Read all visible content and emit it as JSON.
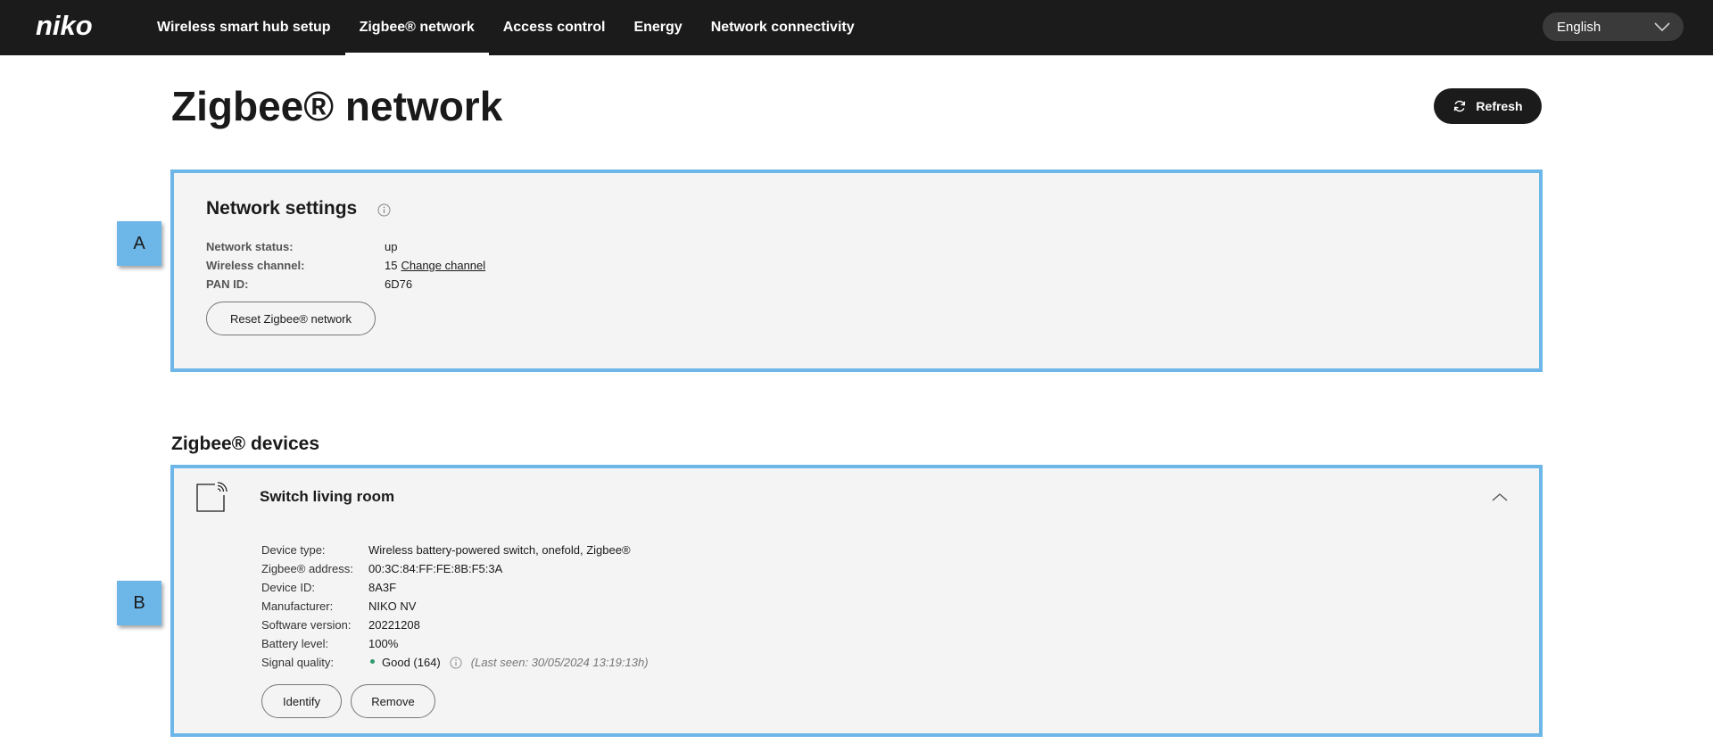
{
  "brand": {
    "logo_text": "niko"
  },
  "nav": {
    "items": [
      {
        "label": "Wireless smart hub setup"
      },
      {
        "label": "Zigbee® network",
        "active": true
      },
      {
        "label": "Access control"
      },
      {
        "label": "Energy"
      },
      {
        "label": "Network connectivity"
      }
    ],
    "language": "English"
  },
  "page": {
    "title": "Zigbee® network",
    "refresh_label": "Refresh"
  },
  "markers": {
    "a": "A",
    "b": "B"
  },
  "network_settings": {
    "title": "Network settings",
    "status_label": "Network status:",
    "status_value": "up",
    "channel_label": "Wireless channel:",
    "channel_value": "15",
    "change_channel_label": "Change channel",
    "pan_label": "PAN ID:",
    "pan_value": "6D76",
    "reset_label": "Reset Zigbee® network"
  },
  "devices": {
    "section_title": "Zigbee® devices",
    "device": {
      "name": "Switch living room",
      "type_label": "Device type:",
      "type_value": "Wireless battery-powered switch, onefold, Zigbee®",
      "address_label": "Zigbee® address:",
      "address_value": "00:3C:84:FF:FE:8B:F5:3A",
      "id_label": "Device ID:",
      "id_value": "8A3F",
      "manufacturer_label": "Manufacturer:",
      "manufacturer_value": "NIKO NV",
      "software_label": "Software version:",
      "software_value": "20221208",
      "battery_label": "Battery level:",
      "battery_value": "100%",
      "signal_label": "Signal quality:",
      "signal_value": "Good (164)",
      "last_seen": "(Last seen: 30/05/2024 13:19:13h)",
      "identify_label": "Identify",
      "remove_label": "Remove"
    }
  },
  "colors": {
    "accent_border": "#6db6e8",
    "topbar": "#1b1b1b",
    "signal_good": "#2e9a6e",
    "panel_bg": "#f4f4f4"
  }
}
